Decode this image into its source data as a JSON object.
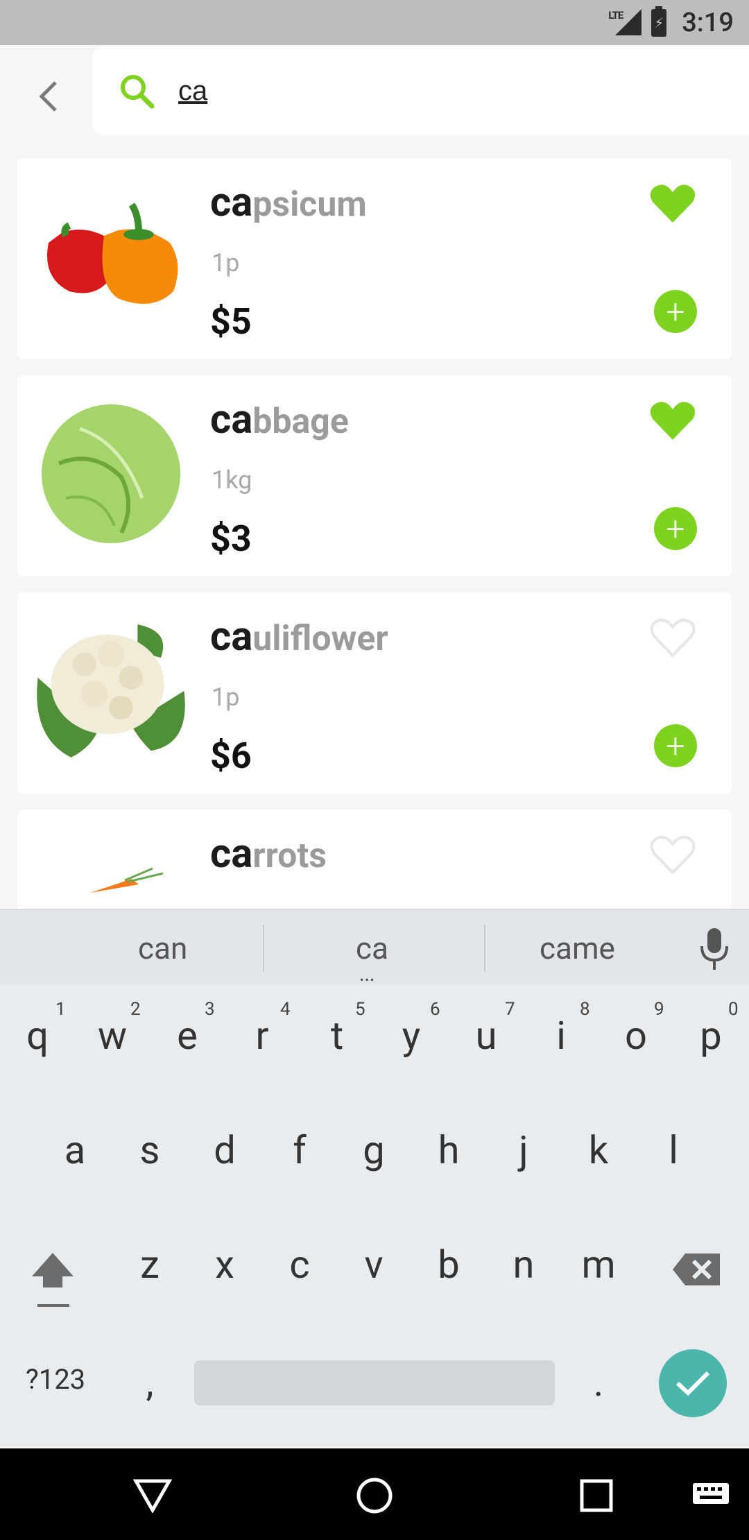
{
  "status_bar": {
    "network": "LTE",
    "time": "3:19"
  },
  "search": {
    "query": "ca",
    "placeholder": ""
  },
  "products": [
    {
      "match": "ca",
      "rest": "psicum",
      "unit": "1p",
      "price": "$5",
      "favorite": true
    },
    {
      "match": "ca",
      "rest": "bbage",
      "unit": "1kg",
      "price": "$3",
      "favorite": true
    },
    {
      "match": "ca",
      "rest": "uliflower",
      "unit": "1p",
      "price": "$6",
      "favorite": false
    },
    {
      "match": "ca",
      "rest": "rrots",
      "unit": "",
      "price": "",
      "favorite": false
    }
  ],
  "colors": {
    "accent": "#7ed321",
    "enter": "#4db6ac",
    "status_bar": "#bdbdbd"
  },
  "keyboard": {
    "suggestions": [
      "can",
      "ca",
      "came"
    ],
    "row1": [
      "q",
      "w",
      "e",
      "r",
      "t",
      "y",
      "u",
      "i",
      "o",
      "p"
    ],
    "row1_numbers": [
      "1",
      "2",
      "3",
      "4",
      "5",
      "6",
      "7",
      "8",
      "9",
      "0"
    ],
    "row2": [
      "a",
      "s",
      "d",
      "f",
      "g",
      "h",
      "j",
      "k",
      "l"
    ],
    "row3": [
      "z",
      "x",
      "c",
      "v",
      "b",
      "n",
      "m"
    ],
    "symbols_key": "?123",
    "comma": ",",
    "period": "."
  }
}
